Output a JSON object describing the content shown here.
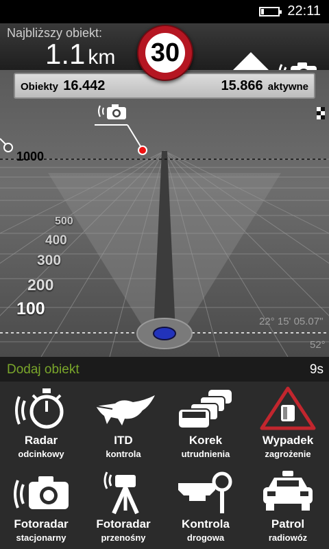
{
  "status": {
    "time": "22:11",
    "battery_level": 0.15
  },
  "header": {
    "nearest_label": "Najbliższy obiekt:",
    "distance_value": "1.1",
    "distance_unit": "km",
    "speed_limit": "30",
    "direction_icon": "arrow-up-icon",
    "camera_icon": "speed-camera-icon"
  },
  "counters": {
    "objects_label": "Obiekty",
    "objects_total": "16.442",
    "active_count": "15.866",
    "active_label": "aktywne"
  },
  "map": {
    "scale_labels": [
      "1000",
      "500",
      "400",
      "300",
      "200",
      "100"
    ],
    "coordinate": "22° 15' 05.07\"",
    "coordinate_secondary": "52°"
  },
  "add_bar": {
    "title": "Dodaj obiekt",
    "timer": "9s"
  },
  "objects": [
    {
      "title": "Radar",
      "subtitle": "odcinkowy",
      "icon": "section-radar-icon"
    },
    {
      "title": "ITD",
      "subtitle": "kontrola",
      "icon": "crocodile-icon"
    },
    {
      "title": "Korek",
      "subtitle": "utrudnienia",
      "icon": "traffic-jam-icon"
    },
    {
      "title": "Wypadek",
      "subtitle": "zagrożenie",
      "icon": "accident-warning-icon"
    },
    {
      "title": "Fotoradar",
      "subtitle": "stacjonarny",
      "icon": "fixed-camera-icon"
    },
    {
      "title": "Fotoradar",
      "subtitle": "przenośny",
      "icon": "mobile-camera-icon"
    },
    {
      "title": "Kontrola",
      "subtitle": "drogowa",
      "icon": "police-control-icon"
    },
    {
      "title": "Patrol",
      "subtitle": "radiowóz",
      "icon": "police-car-icon"
    }
  ],
  "colors": {
    "accent_green": "#7aa62b",
    "speed_sign_red": "#b51622"
  }
}
